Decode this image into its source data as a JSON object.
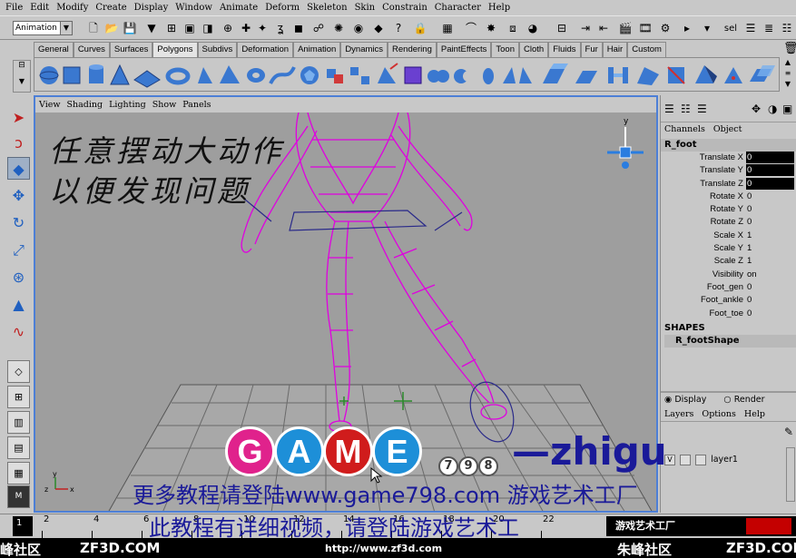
{
  "menubar": [
    "File",
    "Edit",
    "Modify",
    "Create",
    "Display",
    "Window",
    "Animate",
    "Deform",
    "Skeleton",
    "Skin",
    "Constrain",
    "Character",
    "Help"
  ],
  "status": {
    "mode": "Animation",
    "sel_label": "sel"
  },
  "shelf": {
    "tabs": [
      "General",
      "Curves",
      "Surfaces",
      "Polygons",
      "Subdivs",
      "Deformation",
      "Animation",
      "Dynamics",
      "Rendering",
      "PaintEffects",
      "Toon",
      "Cloth",
      "Fluids",
      "Fur",
      "Hair",
      "Custom"
    ],
    "active_tab": "Polygons"
  },
  "viewport": {
    "panel_menu": [
      "View",
      "Shading",
      "Lighting",
      "Show",
      "Panels"
    ],
    "axis": {
      "x": "x",
      "y": "y",
      "z": "z"
    }
  },
  "channelbox": {
    "menu": [
      "Channels",
      "Object"
    ],
    "node": "R_foot",
    "attributes": [
      {
        "name": "Translate X",
        "value": "0",
        "highlight": true
      },
      {
        "name": "Translate Y",
        "value": "0",
        "highlight": true
      },
      {
        "name": "Translate Z",
        "value": "0",
        "highlight": true
      },
      {
        "name": "Rotate X",
        "value": "0",
        "highlight": false
      },
      {
        "name": "Rotate Y",
        "value": "0",
        "highlight": false
      },
      {
        "name": "Rotate Z",
        "value": "0",
        "highlight": false
      },
      {
        "name": "Scale X",
        "value": "1",
        "highlight": false
      },
      {
        "name": "Scale Y",
        "value": "1",
        "highlight": false
      },
      {
        "name": "Scale Z",
        "value": "1",
        "highlight": false
      },
      {
        "name": "Visibility",
        "value": "on",
        "highlight": false
      },
      {
        "name": "Foot_gen",
        "value": "0",
        "highlight": false
      },
      {
        "name": "Foot_ankle",
        "value": "0",
        "highlight": false
      },
      {
        "name": "Foot_toe",
        "value": "0",
        "highlight": false
      }
    ],
    "shapes_header": "SHAPES",
    "shape": "R_footShape"
  },
  "layers": {
    "radio_display": "Display",
    "radio_render": "Render",
    "menu": [
      "Layers",
      "Options",
      "Help"
    ],
    "layer_v": "V",
    "layer_name": "layer1"
  },
  "timeslider": {
    "ticks": [
      "2",
      "4",
      "6",
      "8",
      "10",
      "12",
      "14",
      "16",
      "18",
      "20",
      "22"
    ],
    "start": "1",
    "right_text": "游戏艺术工厂"
  },
  "overlays": {
    "hand_line1": "任意摆动大动作",
    "hand_line2": "以便发现问题",
    "game_letters": [
      "G",
      "A",
      "M",
      "E"
    ],
    "game_numbers": [
      "7",
      "9",
      "8"
    ],
    "zhigu": "—zhigu",
    "promo1": "更多教程请登陆www.game798.com 游戏艺术工厂",
    "promo2": "此教程有详细视频，请登陆游戏艺术工"
  },
  "bottombar": {
    "left": "峰社区",
    "left_url": "ZF3D.COM",
    "center_url": "http://www.zf3d.com",
    "right": "朱峰社区",
    "right_url": "ZF3D.COM"
  },
  "colors": {
    "viewport_border": "#4d7fd6",
    "wire": "#e000e0",
    "game_g": "#e0228c",
    "game_a": "#1d8fd8",
    "game_m": "#d01c1c",
    "game_e": "#1d8fd8"
  }
}
